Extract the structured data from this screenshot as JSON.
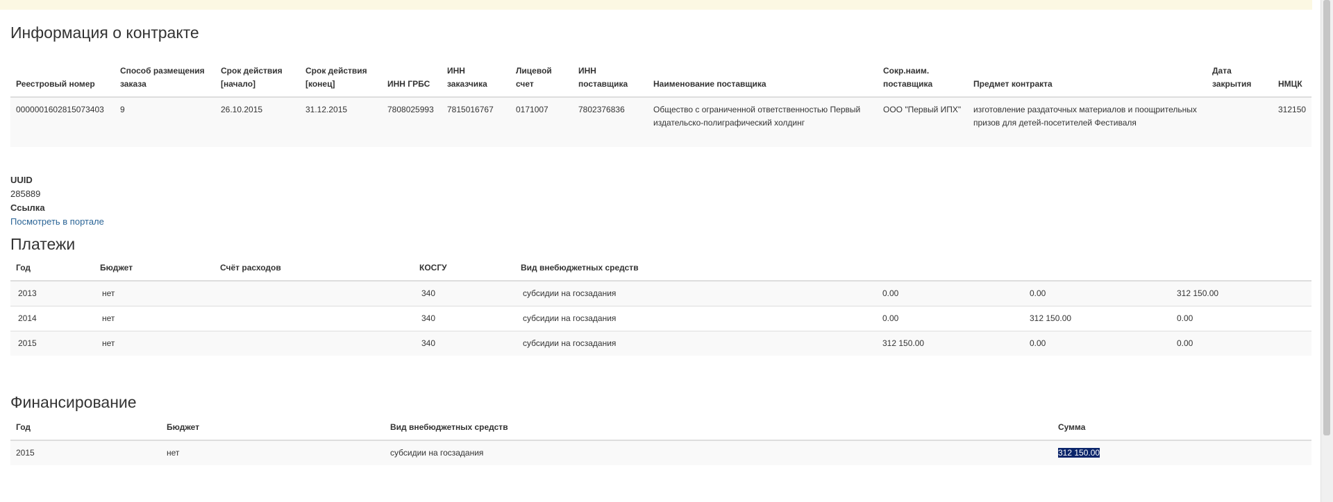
{
  "contract": {
    "title": "Информация о контракте",
    "headers": [
      "Реестровый номер",
      "Способ размещения заказа",
      "Срок действия [начало]",
      "Срок действия [конец]",
      "ИНН ГРБС",
      "ИНН заказчика",
      "Лицевой счет",
      "ИНН поставщика",
      "Наименование поставщика",
      "Сокр.наим. поставщика",
      "Предмет контракта",
      "Дата закрытия",
      "НМЦК"
    ],
    "row": [
      "0000001602815073403",
      "9",
      "26.10.2015",
      "31.12.2015",
      "7808025993",
      "7815016767",
      "0171007",
      "7802376836",
      "Общество с ограниченной ответственностью Первый издательско-полиграфический холдинг",
      "ООО \"Первый ИПХ\"",
      "изготовление раздаточных материалов и поощрительных призов для детей-посетителей Фестиваля",
      "",
      "312150"
    ]
  },
  "info": {
    "uuid_label": "UUID",
    "uuid_value": "285889",
    "link_label": "Ссылка",
    "link_text": "Посмотреть в портале"
  },
  "payments": {
    "title": "Платежи",
    "headers": [
      "Год",
      "Бюджет",
      "Счёт расходов",
      "КОСГУ",
      "Вид внебюджетных средств",
      "",
      "",
      ""
    ],
    "rows": [
      [
        "2013",
        "нет",
        "",
        "340",
        "субсидии на госзадания",
        "0.00",
        "0.00",
        "312 150.00"
      ],
      [
        "2014",
        "нет",
        "",
        "340",
        "субсидии на госзадания",
        "0.00",
        "312 150.00",
        "0.00"
      ],
      [
        "2015",
        "нет",
        "",
        "340",
        "субсидии на госзадания",
        "312 150.00",
        "0.00",
        "0.00"
      ]
    ]
  },
  "financing": {
    "title": "Финансирование",
    "headers": [
      "Год",
      "Бюджет",
      "Вид внебюджетных средств",
      "Сумма"
    ],
    "row": [
      "2015",
      "нет",
      "субсидии на госзадания",
      "312 150.00"
    ]
  },
  "colors": {
    "notice_bar": "#fcf8e3",
    "link": "#2a6496",
    "selection": "#0a246a"
  }
}
